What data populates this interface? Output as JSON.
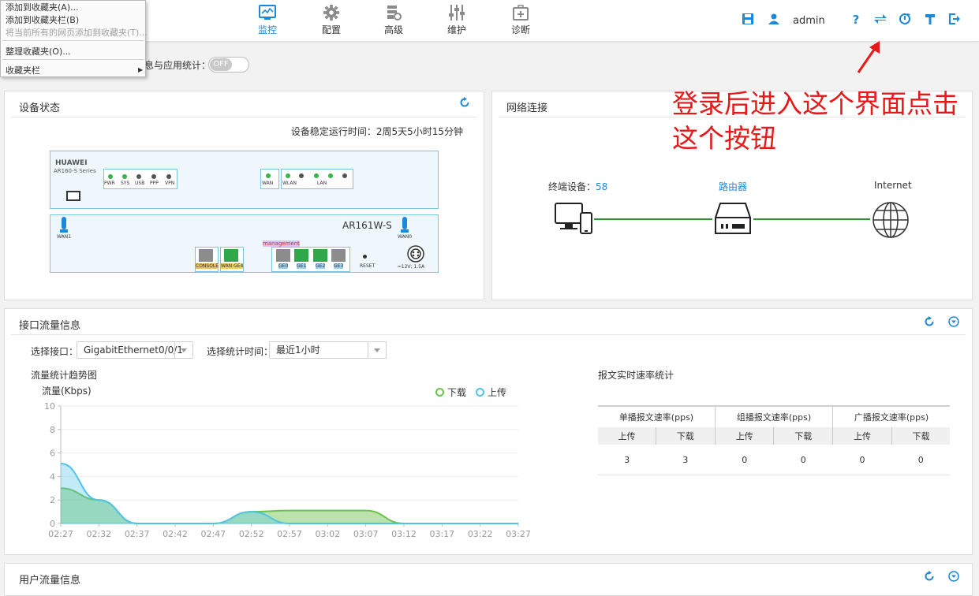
{
  "browser_menu": {
    "items": [
      "添加到收藏夹(A)...",
      "添加到收藏夹栏(B)",
      "将当前所有的网页添加到收藏夹(T)...",
      "整理收藏夹(O)...",
      "收藏夹栏"
    ]
  },
  "nav": [
    {
      "label": "监控",
      "icon": "monitor-icon",
      "active": true
    },
    {
      "label": "配置",
      "icon": "gear-icon",
      "active": false
    },
    {
      "label": "高级",
      "icon": "advanced-icon",
      "active": false
    },
    {
      "label": "维护",
      "icon": "sliders-icon",
      "active": false
    },
    {
      "label": "诊断",
      "icon": "medical-kit-icon",
      "active": false
    }
  ],
  "topright": {
    "user": "admin",
    "icons": [
      "save-icon",
      "user-icon",
      "help-icon",
      "switch-icon",
      "reboot-icon",
      "tools-icon",
      "logout-icon"
    ]
  },
  "stats_toggle": {
    "label": "息与应用统计：",
    "state": "OFF"
  },
  "device_status": {
    "title": "设备状态",
    "uptime": "设备稳定运行时间：2周5天5小时15分钟",
    "brand": "HUAWEI",
    "series": "AR160-S Series",
    "model": "AR161W-S",
    "leds": [
      "PWR",
      "SYS",
      "USB",
      "PPP",
      "VPN"
    ],
    "wan_label": "WAN",
    "wlan_label": "WLAN",
    "lan_label": "LAN",
    "antenna_labels": [
      "WAN1",
      "WAN0"
    ],
    "management_label": "management",
    "ports": [
      "CONSOLE",
      "WAN GE4",
      "GE0",
      "GE1",
      "GE2",
      "GE3"
    ],
    "reset_label": "RESET",
    "power_label": "⎓12V; 1.5A"
  },
  "network": {
    "title": "网络连接",
    "terminal_label": "终端设备：",
    "terminal_count": "58",
    "router_label": "路由器",
    "internet_label": "Internet"
  },
  "annotation": "登录后进入这个界面点击这个按钮",
  "interface_traffic": {
    "title": "接口流量信息",
    "select_interface_label": "选择接口：",
    "interface_value": "GigabitEthernet0/0/1",
    "select_time_label": "选择统计时间：",
    "time_value": "最近1小时",
    "trend_title": "流量统计趋势图",
    "realtime_title": "报文实时速率统计"
  },
  "rate_table": {
    "groups": [
      "单播报文速率(pps)",
      "组播报文速率(pps)",
      "广播报文速率(pps)"
    ],
    "sub": [
      "上传",
      "下载"
    ],
    "values": [
      "3",
      "3",
      "0",
      "0",
      "0",
      "0"
    ]
  },
  "user_traffic": {
    "title": "用户流量信息"
  },
  "colors": {
    "accent": "#1e88d8",
    "download": "#6cc24a",
    "upload": "#4fc3e8",
    "annotation": "#e81818"
  },
  "chart_data": {
    "type": "area",
    "ylabel": "流量(Kbps)",
    "ylim": [
      0,
      10
    ],
    "yticks": [
      0,
      2,
      4,
      6,
      8,
      10
    ],
    "x": [
      "02:27",
      "02:32",
      "02:37",
      "02:42",
      "02:47",
      "02:52",
      "02:57",
      "03:02",
      "03:07",
      "03:12",
      "03:17",
      "03:22",
      "03:27"
    ],
    "legend_position": "top-right",
    "series": [
      {
        "name": "下载",
        "color": "#6cc24a",
        "values": [
          3,
          2,
          0,
          0,
          0,
          1,
          1.1,
          1.1,
          1.1,
          0,
          0,
          0,
          0
        ]
      },
      {
        "name": "上传",
        "color": "#4fc3e8",
        "values": [
          5.1,
          2,
          0,
          0,
          0,
          1,
          0,
          0,
          0,
          0,
          0,
          0,
          0
        ]
      }
    ]
  }
}
